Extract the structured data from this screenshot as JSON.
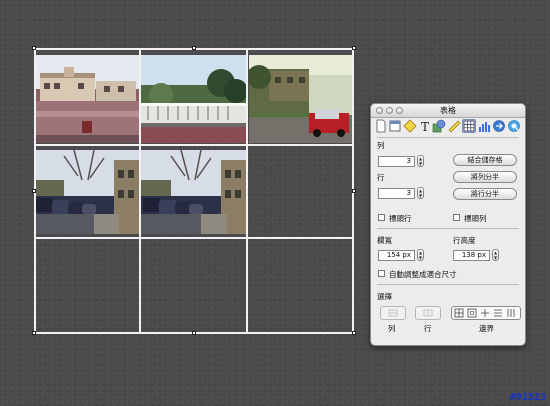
{
  "panel": {
    "title": "表格",
    "section_columns": "列",
    "columns_value": "3",
    "merge_cells_label": "結合儲存格",
    "section_rows": "行",
    "rows_value": "3",
    "split_columns_label": "將列分半",
    "split_rows_label": "將行分半",
    "header_row_label": "標頭行",
    "header_column_label": "標頭列",
    "column_width_label": "欄寬",
    "column_width_value": "154 px",
    "row_height_label": "行高度",
    "row_height_value": "138 px",
    "auto_resize_label": "自動調整成適合尺寸",
    "select_label": "選擇",
    "select_column_label": "列",
    "select_row_label": "行",
    "select_border_label": "邊界"
  },
  "toolbar_icons": [
    "document-icon",
    "window-icon",
    "graphics-icon",
    "text-icon",
    "shapes-icon",
    "ruler-icon",
    "table-icon",
    "chart-icon",
    "link-icon",
    "quicktime-icon"
  ],
  "images": [
    "street-scene-photo",
    "bridge-photo",
    "houses-car-photo",
    "parked-cars-photo",
    "parked-cars-photo-copy"
  ],
  "watermark": "#91523"
}
